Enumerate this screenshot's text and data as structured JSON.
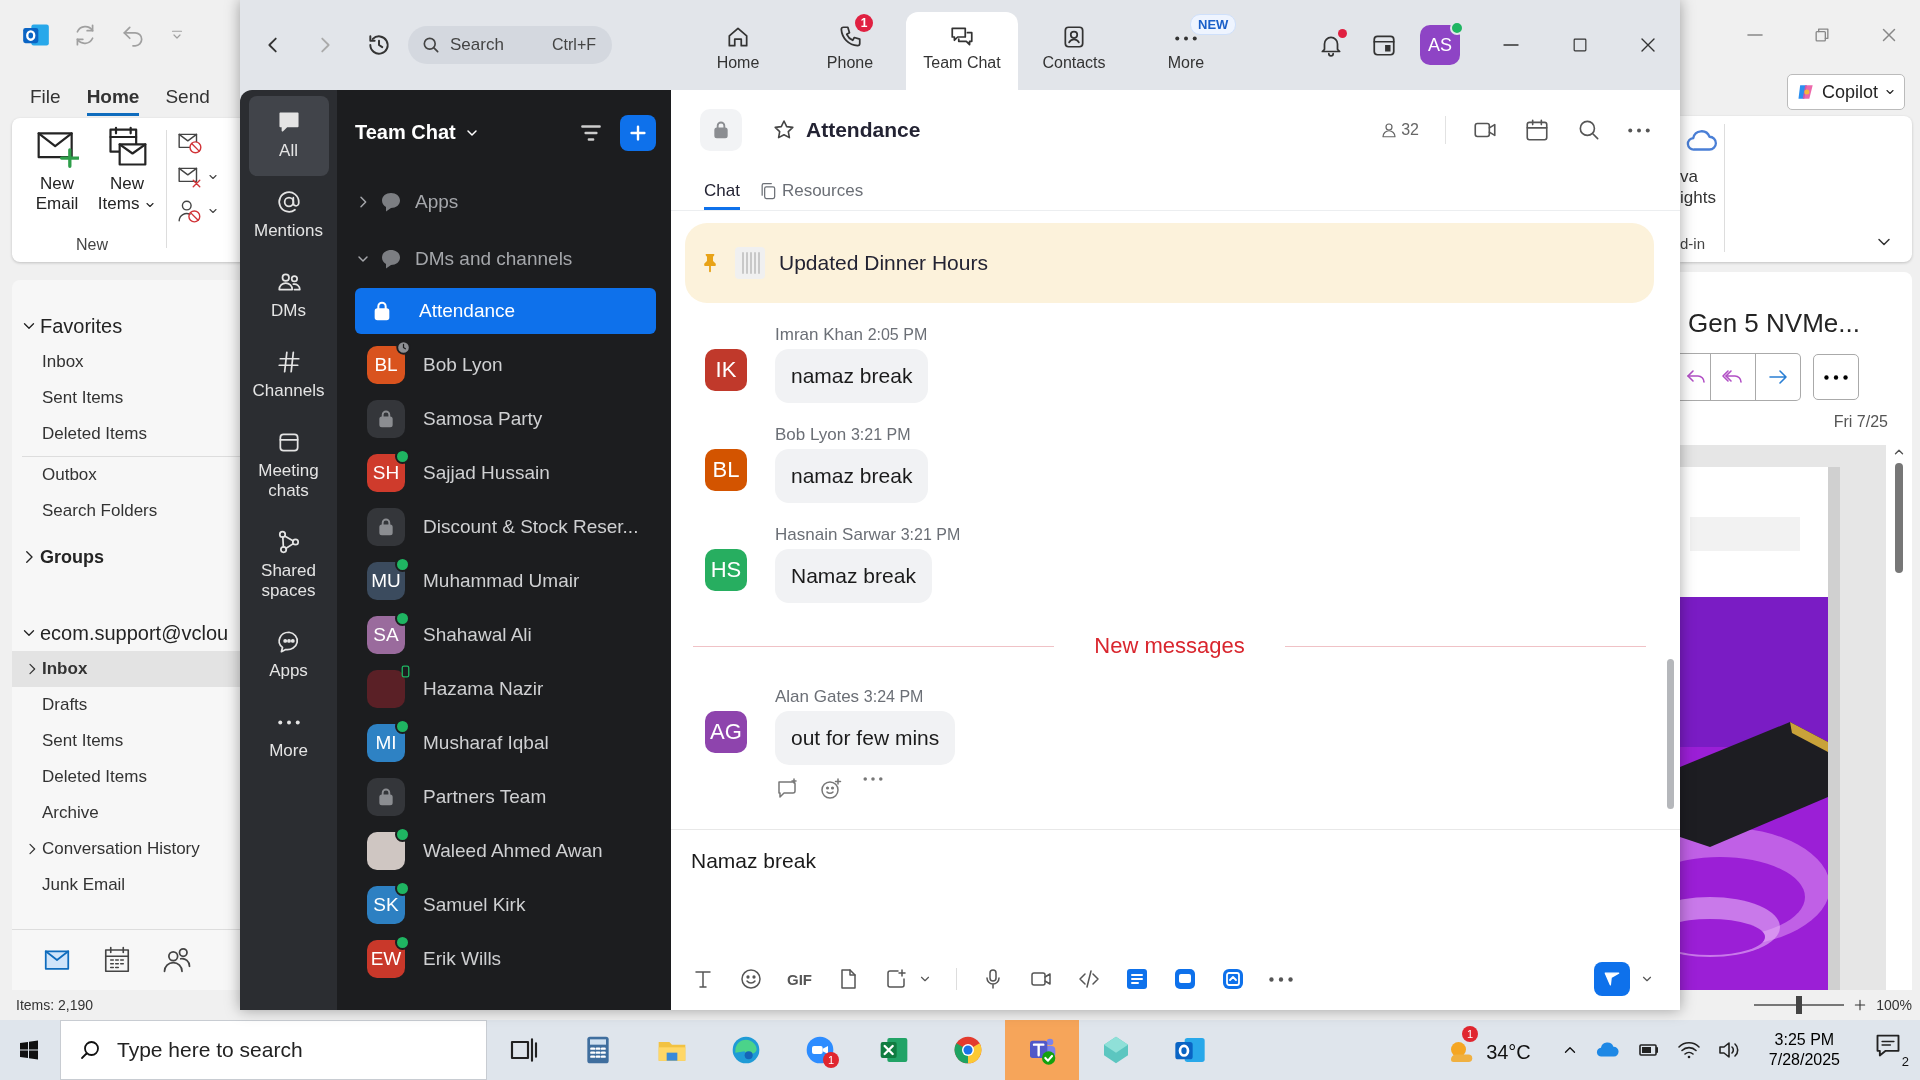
{
  "outlook": {
    "ribbon_tabs": [
      {
        "label": "File",
        "selected": false
      },
      {
        "label": "Home",
        "selected": true
      },
      {
        "label": "Send",
        "selected": false
      }
    ],
    "ribbon_buttons": [
      {
        "label": "New Email",
        "kind": "new_email",
        "dropdown": false
      },
      {
        "label": "New Items",
        "kind": "new_items",
        "dropdown": true
      }
    ],
    "ribbon_group": "New",
    "copilot": "Copilot",
    "addin_button_lines": [
      "va",
      "ights"
    ],
    "addin_group": "d-in",
    "folder_sections": [
      {
        "header": "Favorites",
        "expanded": true,
        "items": [
          {
            "label": "Inbox",
            "selected": false,
            "expandable": false
          },
          {
            "label": "Sent Items",
            "selected": false,
            "expandable": false
          },
          {
            "label": "Deleted Items",
            "selected": false,
            "expandable": false
          }
        ]
      },
      {
        "items": [
          {
            "label": "Outbox",
            "selected": false,
            "expandable": false
          },
          {
            "label": "Search Folders",
            "selected": false,
            "expandable": false
          }
        ]
      },
      {
        "header": "Groups",
        "expanded": false
      },
      {
        "header": "ecom.support@vclou",
        "expanded": true,
        "items": [
          {
            "label": "Inbox",
            "selected": true,
            "expandable": true
          },
          {
            "label": "Drafts",
            "selected": false,
            "expandable": false
          },
          {
            "label": "Sent Items",
            "selected": false,
            "expandable": false
          },
          {
            "label": "Deleted Items",
            "selected": false,
            "expandable": false
          },
          {
            "label": "Archive",
            "selected": false,
            "expandable": false
          },
          {
            "label": "Conversation History",
            "selected": false,
            "expandable": true
          },
          {
            "label": "Junk Email",
            "selected": false,
            "expandable": false
          }
        ]
      }
    ],
    "reading_pane": {
      "subject": "Gen 5 NVMe...",
      "date": "Fri 7/25"
    },
    "status": "Items: 2,190",
    "zoom_slider": {
      "level": 0.5
    },
    "zoom_level": "100%"
  },
  "zoom": {
    "top_bar": {
      "search": {
        "placeholder": "Search",
        "shortcut": "Ctrl+F"
      },
      "nav": [
        {
          "label": "Home",
          "selected": false
        },
        {
          "label": "Phone",
          "badge": {
            "text": "1",
            "kind": "count"
          },
          "selected": false
        },
        {
          "label": "Team Chat",
          "selected": true
        },
        {
          "label": "Contacts",
          "selected": false
        },
        {
          "label": "More",
          "badge": {
            "text": "NEW",
            "kind": "new"
          },
          "selected": false
        }
      ],
      "notifications_unread": true,
      "avatar": {
        "initials": "AS",
        "online": true
      }
    },
    "rail": [
      {
        "label": "All",
        "selected": true
      },
      {
        "label": "Mentions",
        "selected": false
      },
      {
        "label": "DMs",
        "selected": false
      },
      {
        "label": "Channels",
        "selected": false
      },
      {
        "label": "Meeting chats",
        "selected": false
      },
      {
        "label": "Shared spaces",
        "selected": false
      },
      {
        "label": "Apps",
        "selected": false
      },
      {
        "label": "More",
        "selected": false
      }
    ],
    "chat_list": {
      "title": "Team Chat",
      "sections": [
        {
          "label": "Apps",
          "expanded": false
        },
        {
          "label": "DMs and channels",
          "expanded": true
        }
      ],
      "items": [
        {
          "name": "Attendance",
          "kind": "channel",
          "online": false,
          "away": false,
          "on_mobile": false,
          "selected": true
        },
        {
          "name": "Bob Lyon",
          "kind": "person",
          "initials": "BL",
          "color": "#d9531e",
          "online": false,
          "away": true,
          "on_mobile": false,
          "selected": false
        },
        {
          "name": "Samosa Party",
          "kind": "channel",
          "online": false,
          "away": false,
          "on_mobile": false,
          "selected": false
        },
        {
          "name": "Sajjad Hussain",
          "kind": "person",
          "initials": "SH",
          "color": "#cf3b2c",
          "online": true,
          "away": false,
          "on_mobile": false,
          "selected": false
        },
        {
          "name": "Discount & Stock Reser...",
          "kind": "channel",
          "online": false,
          "away": false,
          "on_mobile": false,
          "selected": false
        },
        {
          "name": "Muhammad Umair",
          "kind": "person",
          "initials": "MU",
          "color": "#3b4b5e",
          "online": true,
          "away": false,
          "on_mobile": false,
          "selected": false
        },
        {
          "name": "Shahawal Ali",
          "kind": "person",
          "initials": "SA",
          "color": "#9a6b9d",
          "online": true,
          "away": false,
          "on_mobile": false,
          "selected": false
        },
        {
          "name": "Hazama Nazir",
          "color": "#5a2026",
          "online": false,
          "away": false,
          "on_mobile": true,
          "selected": false
        },
        {
          "name": "Musharaf Iqbal",
          "kind": "person",
          "initials": "MI",
          "color": "#2e82c4",
          "online": true,
          "away": false,
          "on_mobile": false,
          "selected": false
        },
        {
          "name": "Partners Team",
          "kind": "channel",
          "online": false,
          "away": false,
          "on_mobile": false,
          "selected": false
        },
        {
          "name": "Waleed Ahmed Awan",
          "color": "#cfc6c2",
          "online": true,
          "away": false,
          "on_mobile": false,
          "selected": false
        },
        {
          "name": "Samuel Kirk",
          "kind": "person",
          "initials": "SK",
          "color": "#2d80c2",
          "online": true,
          "away": false,
          "on_mobile": false,
          "selected": false
        },
        {
          "name": "Erik Wills",
          "kind": "person",
          "initials": "EW",
          "color": "#c9382a",
          "online": true,
          "away": false,
          "on_mobile": false,
          "selected": false
        }
      ]
    },
    "conversation": {
      "title": "Attendance",
      "member_count": "32",
      "tabs": [
        {
          "label": "Chat",
          "selected": true
        },
        {
          "label": "Resources",
          "selected": false
        }
      ],
      "pinned": "Updated Dinner Hours",
      "messages": [
        {
          "kind": "message",
          "sender": "Imran Khan",
          "time": "2:05 PM",
          "initials": "IK",
          "color": "#c0392b",
          "text": "namaz break",
          "show_actions": false
        },
        {
          "kind": "message",
          "sender": "Bob Lyon",
          "time": "3:21 PM",
          "initials": "BL",
          "color": "#d35400",
          "text": "namaz break",
          "show_actions": false
        },
        {
          "kind": "message",
          "sender": "Hasnain Sarwar",
          "time": "3:21 PM",
          "initials": "HS",
          "color": "#27ae60",
          "text": "Namaz break",
          "show_actions": false
        },
        {
          "kind": "divider",
          "label": "New messages"
        },
        {
          "kind": "message",
          "sender": "Alan Gates",
          "time": "3:24 PM",
          "initials": "AG",
          "color": "#8e44ad",
          "text": "out for few mins",
          "show_actions": true
        }
      ],
      "composer": {
        "value": "Namaz break",
        "tools": [
          {
            "kind": "text"
          },
          {
            "kind": "emoji"
          },
          {
            "kind": "gif",
            "label": "GIF"
          },
          {
            "kind": "file"
          },
          {
            "kind": "screenshot"
          },
          {
            "kind": "separator"
          },
          {
            "kind": "mic"
          },
          {
            "kind": "video"
          },
          {
            "kind": "code"
          },
          {
            "kind": "app_notes"
          },
          {
            "kind": "app_chat"
          },
          {
            "kind": "app_board"
          },
          {
            "kind": "more"
          }
        ]
      }
    }
  },
  "taskbar": {
    "search": {
      "placeholder": "Type here to search"
    },
    "apps": [
      {
        "kind": "task_view",
        "flashing": false
      },
      {
        "kind": "calculator",
        "flashing": false
      },
      {
        "kind": "explorer",
        "flashing": false
      },
      {
        "kind": "edge",
        "flashing": false
      },
      {
        "kind": "zoom",
        "badge": "1",
        "flashing": false
      },
      {
        "kind": "excel",
        "flashing": false
      },
      {
        "kind": "chrome",
        "flashing": false
      },
      {
        "kind": "teams",
        "flashing": true
      },
      {
        "kind": "app",
        "flashing": false
      },
      {
        "kind": "outlook",
        "flashing": false
      }
    ],
    "weather": {
      "temperature": "34°C",
      "badge": "1"
    },
    "time": "3:25 PM",
    "date": "7/28/2025",
    "notification_count": "2"
  }
}
